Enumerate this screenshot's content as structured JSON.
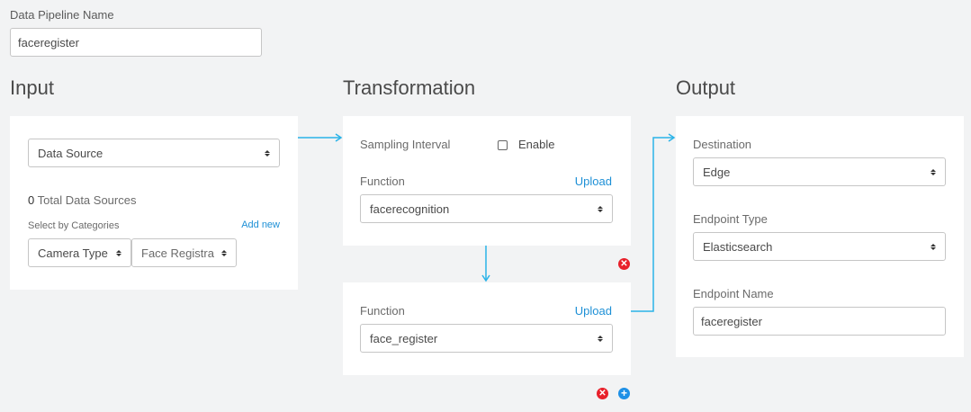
{
  "pipeline": {
    "name_label": "Data Pipeline Name",
    "name_value": "faceregister"
  },
  "input": {
    "title": "Input",
    "data_source": "Data Source",
    "total_count": "0",
    "total_label": "Total Data Sources",
    "select_by_label": "Select by Categories",
    "add_new": "Add new",
    "category_1": "Camera Type",
    "category_2": "Face Registra"
  },
  "transformation": {
    "title": "Transformation",
    "sampling_label": "Sampling Interval",
    "enable_label": "Enable",
    "function_label_1": "Function",
    "upload_1": "Upload",
    "function_1": "facerecognition",
    "function_label_2": "Function",
    "upload_2": "Upload",
    "function_2": "face_register",
    "remove_icon_glyph": "✕",
    "add_icon_glyph": "+"
  },
  "output": {
    "title": "Output",
    "destination_label": "Destination",
    "destination": "Edge",
    "endpoint_type_label": "Endpoint Type",
    "endpoint_type": "Elasticsearch",
    "endpoint_name_label": "Endpoint Name",
    "endpoint_name": "faceregister"
  },
  "colors": {
    "accent": "#1e90d6",
    "connector": "#2bb3e8",
    "danger": "#e8202a",
    "add": "#1e90e6"
  }
}
